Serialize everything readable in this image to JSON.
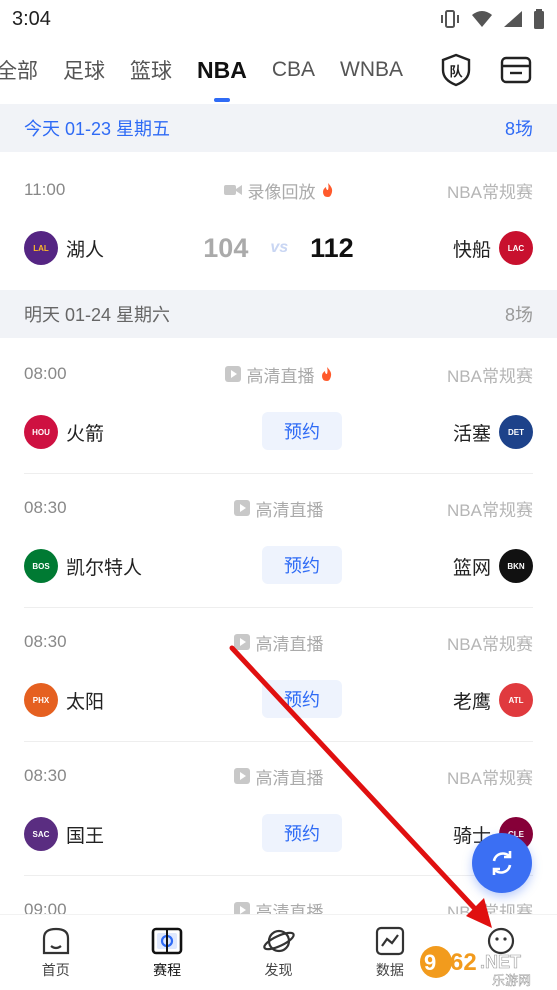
{
  "status_bar": {
    "time": "3:04"
  },
  "tabs": [
    "全部",
    "足球",
    "篮球",
    "NBA",
    "CBA",
    "WNBA"
  ],
  "active_tab": "NBA",
  "tab_icons": {
    "team": "队"
  },
  "days": [
    {
      "label": "今天  01-23  星期五",
      "count": "8场",
      "color": "#2f6bf5"
    },
    {
      "label": "明天  01-24  星期六",
      "count": "8场",
      "color": "#666666"
    }
  ],
  "matches": [
    {
      "time": "11:00",
      "broadcast": "录像回放",
      "league": "NBA常规赛",
      "home": "湖人",
      "home_abbr": "LAL",
      "home_color": "#552583",
      "away": "快船",
      "away_abbr": "LAC",
      "away_color": "#c8102e",
      "home_score": "104",
      "vs": "vs",
      "away_score": "112"
    },
    {
      "time": "08:00",
      "broadcast": "高清直播",
      "league": "NBA常规赛",
      "home": "火箭",
      "home_abbr": "HOU",
      "home_color": "#ce1141",
      "away": "活塞",
      "away_abbr": "DET",
      "away_color": "#1d428a",
      "action": "预约"
    },
    {
      "time": "08:30",
      "broadcast": "高清直播",
      "league": "NBA常规赛",
      "home": "凯尔特人",
      "home_abbr": "BOS",
      "home_color": "#007a33",
      "away": "篮网",
      "away_abbr": "BKN",
      "away_color": "#111111",
      "action": "预约"
    },
    {
      "time": "08:30",
      "broadcast": "高清直播",
      "league": "NBA常规赛",
      "home": "太阳",
      "home_abbr": "PHX",
      "home_color": "#e56020",
      "away": "老鹰",
      "away_abbr": "ATL",
      "away_color": "#e03a3e",
      "action": "预约"
    },
    {
      "time": "08:30",
      "broadcast": "高清直播",
      "league": "NBA常规赛",
      "home": "国王",
      "home_abbr": "SAC",
      "home_color": "#5a2d81",
      "away": "骑士",
      "away_abbr": "CLE",
      "away_color": "#860038",
      "action": "预约"
    },
    {
      "time": "09:00",
      "broadcast": "高清直播",
      "league": "NBA常规赛"
    }
  ],
  "bottom_nav": [
    {
      "label": "首页",
      "icon": "home-icon"
    },
    {
      "label": "赛程",
      "icon": "schedule-icon"
    },
    {
      "label": "发现",
      "icon": "planet-icon"
    },
    {
      "label": "数据",
      "icon": "chart-icon"
    },
    {
      "label": "我的",
      "icon": "profile-icon"
    }
  ],
  "watermark": "962.NET 乐游网",
  "colors": {
    "accent": "#2f6bf5",
    "fab": "#3b6ff3",
    "arrow": "#e01010"
  }
}
